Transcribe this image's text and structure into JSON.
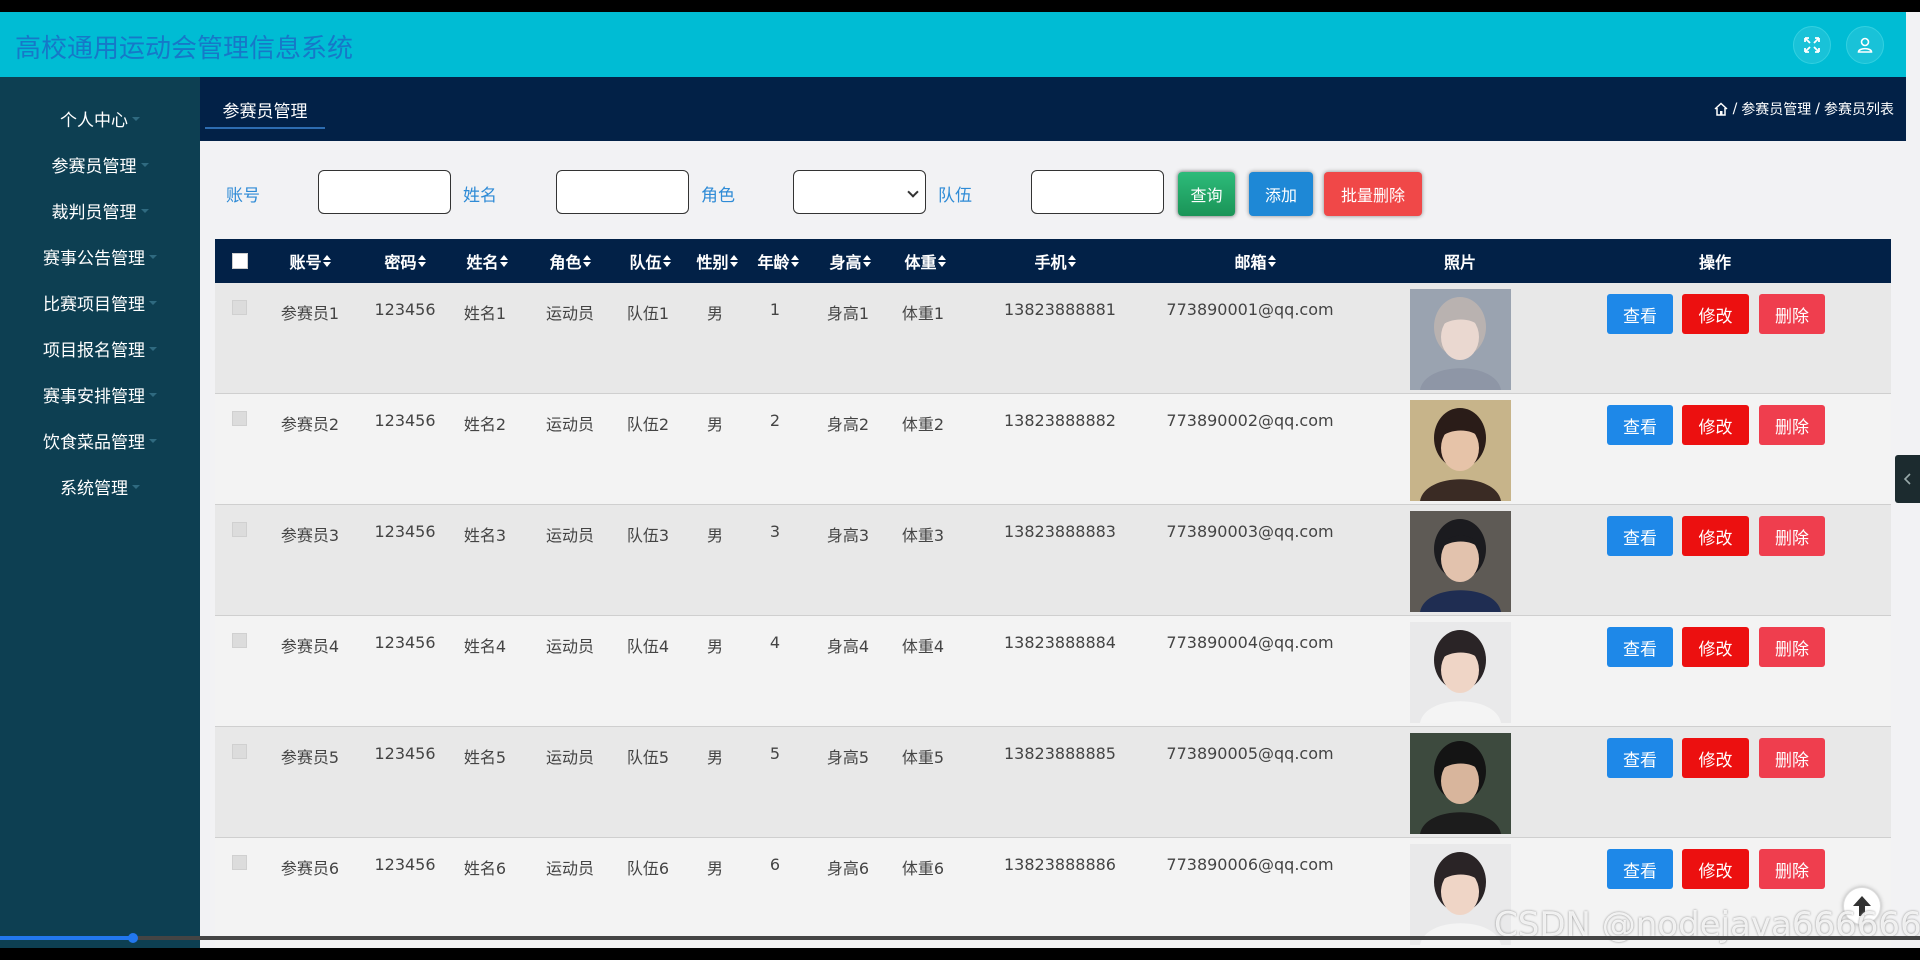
{
  "header": {
    "title": "高校通用运动会管理信息系统",
    "fullscreen_icon": "expand-icon",
    "user_icon": "user-icon"
  },
  "sidebar": {
    "items": [
      {
        "label": "个人中心",
        "has_caret": true
      },
      {
        "label": "参赛员管理",
        "has_caret": true
      },
      {
        "label": "裁判员管理",
        "has_caret": true
      },
      {
        "label": "赛事公告管理",
        "has_caret": true
      },
      {
        "label": "比赛项目管理",
        "has_caret": true
      },
      {
        "label": "项目报名管理",
        "has_caret": true
      },
      {
        "label": "赛事安排管理",
        "has_caret": true
      },
      {
        "label": "饮食菜品管理",
        "has_caret": true
      },
      {
        "label": "系统管理",
        "has_caret": true
      }
    ]
  },
  "tabs": [
    {
      "label": "参赛员管理",
      "active": true
    }
  ],
  "breadcrumb": {
    "home_icon": "home-icon",
    "items": [
      "参赛员管理",
      "参赛员列表"
    ],
    "separator": "/"
  },
  "search": {
    "account_label": "账号",
    "account_value": "",
    "name_label": "姓名",
    "name_value": "",
    "role_label": "角色",
    "role_value": "",
    "team_label": "队伍",
    "team_value": "",
    "query_label": "查询",
    "add_label": "添加",
    "batch_delete_label": "批量删除"
  },
  "table": {
    "columns": [
      "账号",
      "密码",
      "姓名",
      "角色",
      "队伍",
      "性别",
      "年龄",
      "身高",
      "体重",
      "手机",
      "邮箱",
      "照片",
      "操作"
    ],
    "rows": [
      {
        "account": "参赛员1",
        "password": "123456",
        "name": "姓名1",
        "role": "运动员",
        "team": "队伍1",
        "gender": "男",
        "age": "1",
        "height": "身高1",
        "weight": "体重1",
        "phone": "13823888881",
        "email": "773890001@qq.com"
      },
      {
        "account": "参赛员2",
        "password": "123456",
        "name": "姓名2",
        "role": "运动员",
        "team": "队伍2",
        "gender": "男",
        "age": "2",
        "height": "身高2",
        "weight": "体重2",
        "phone": "13823888882",
        "email": "773890002@qq.com"
      },
      {
        "account": "参赛员3",
        "password": "123456",
        "name": "姓名3",
        "role": "运动员",
        "team": "队伍3",
        "gender": "男",
        "age": "3",
        "height": "身高3",
        "weight": "体重3",
        "phone": "13823888883",
        "email": "773890003@qq.com"
      },
      {
        "account": "参赛员4",
        "password": "123456",
        "name": "姓名4",
        "role": "运动员",
        "team": "队伍4",
        "gender": "男",
        "age": "4",
        "height": "身高4",
        "weight": "体重4",
        "phone": "13823888884",
        "email": "773890004@qq.com"
      },
      {
        "account": "参赛员5",
        "password": "123456",
        "name": "姓名5",
        "role": "运动员",
        "team": "队伍5",
        "gender": "男",
        "age": "5",
        "height": "身高5",
        "weight": "体重5",
        "phone": "13823888885",
        "email": "773890005@qq.com"
      },
      {
        "account": "参赛员6",
        "password": "123456",
        "name": "姓名6",
        "role": "运动员",
        "team": "队伍6",
        "gender": "男",
        "age": "6",
        "height": "身高6",
        "weight": "体重6",
        "phone": "13823888886",
        "email": "773890006@qq.com"
      }
    ],
    "actions": {
      "view": "查看",
      "edit": "修改",
      "delete": "删除"
    }
  },
  "watermark": "CSDN @nodejava666666",
  "colors": {
    "header_bg": "#00bcd4",
    "title_color": "#1678c8",
    "sidebar_bg": "#0d3f52",
    "tabbar_bg": "#022147",
    "view_button": "#1e88e8",
    "edit_button": "#ec1010",
    "delete_button": "#ef3e4e",
    "query_button": "#1fa062",
    "add_button": "#1e88d6",
    "batch_delete_button": "#f04848"
  }
}
